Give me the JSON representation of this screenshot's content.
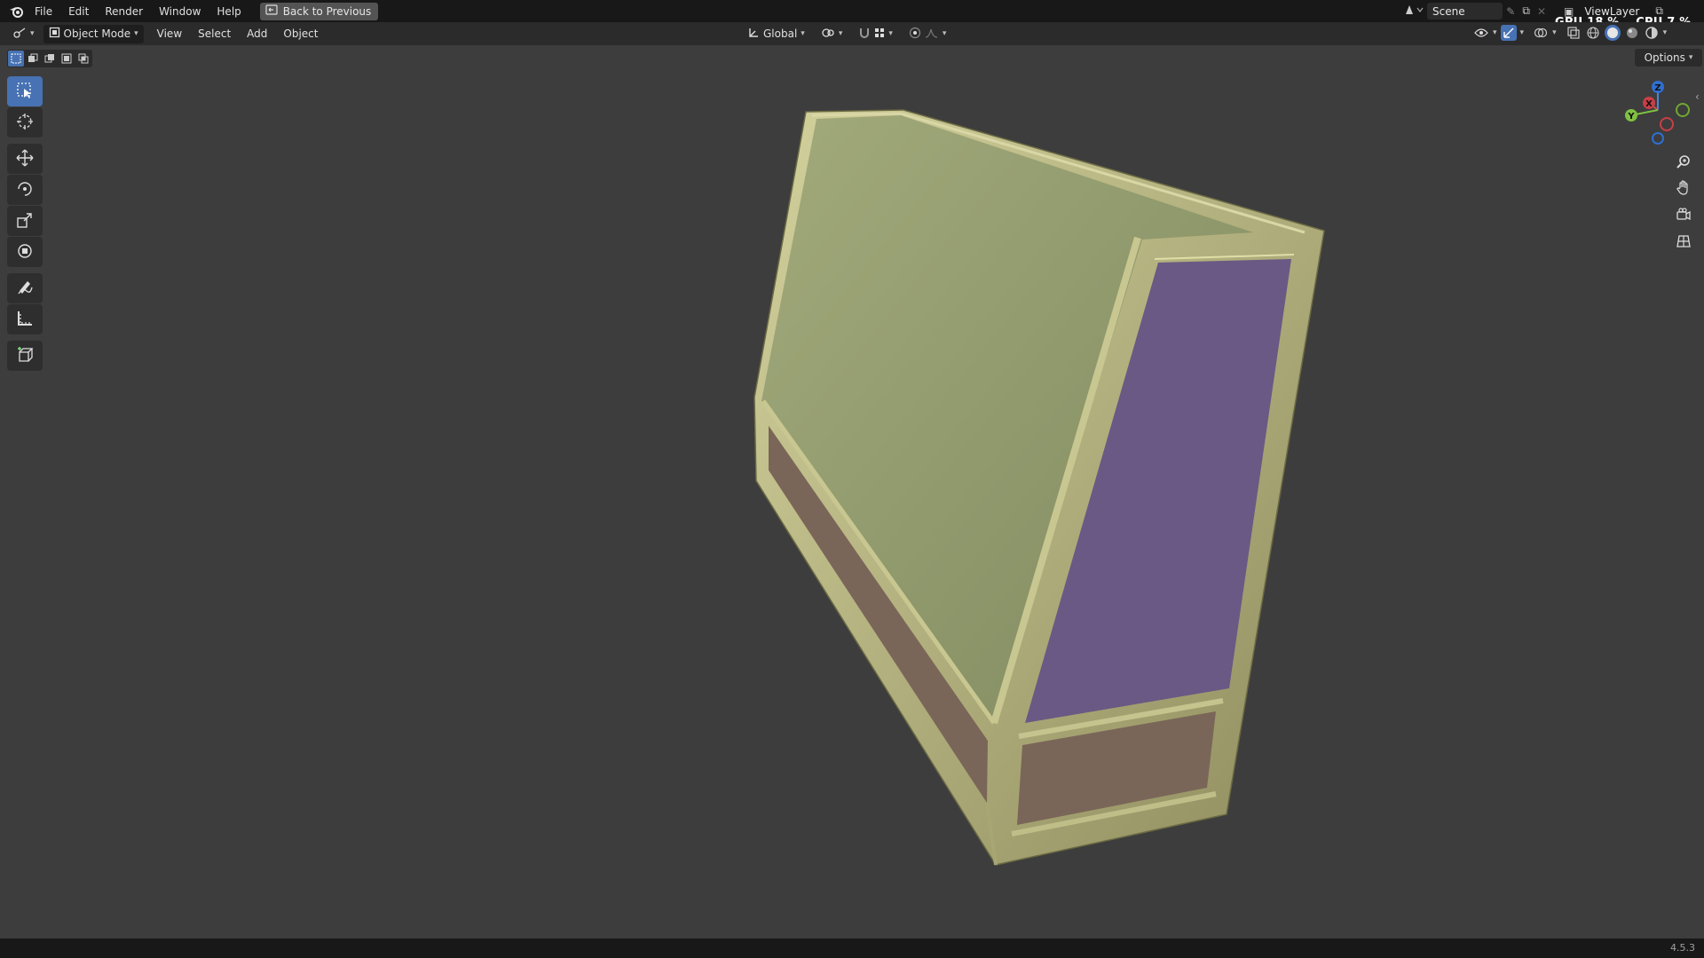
{
  "topbar": {
    "menus": [
      "File",
      "Edit",
      "Render",
      "Window",
      "Help"
    ],
    "back_label": "Back to Previous",
    "scene_name": "Scene",
    "view_layer": "ViewLayer",
    "gpu_label": "GPU",
    "gpu_value": "18 %",
    "cpu_label": "CPU",
    "cpu_value": "7 %"
  },
  "header": {
    "mode": "Object Mode",
    "menus": [
      "View",
      "Select",
      "Add",
      "Object"
    ],
    "orientation": "Global",
    "options_label": "Options"
  },
  "toolbar": {
    "tools": [
      "select-box",
      "cursor",
      "move",
      "rotate",
      "scale",
      "transform",
      "annotate",
      "measure",
      "add-cube"
    ],
    "active_tool": "select-box"
  },
  "gizmo": {
    "x": "X",
    "y": "Y",
    "z": "Z"
  },
  "status": {
    "version": "4.5.3"
  },
  "colors": {
    "accent": "#4772b3",
    "top_face": "#8b9669",
    "side_face": "#6a5984",
    "bottom_face": "#7a6658",
    "frame": "#b7b57f"
  }
}
